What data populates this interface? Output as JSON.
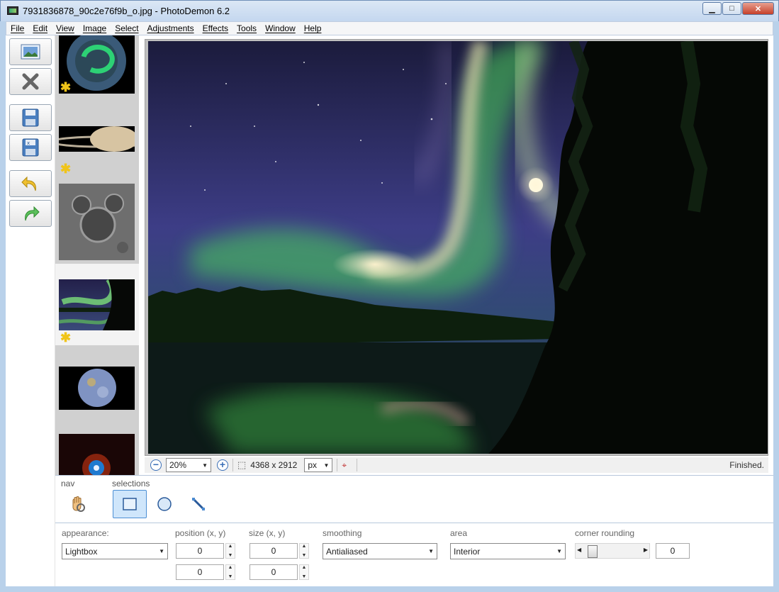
{
  "window": {
    "title": "7931836878_90c2e76f9b_o.jpg  -  PhotoDemon 6.2",
    "controls": [
      "minimize",
      "maximize",
      "close"
    ]
  },
  "menu": [
    "File",
    "Edit",
    "View",
    "Image",
    "Select",
    "Adjustments",
    "Effects",
    "Tools",
    "Window",
    "Help"
  ],
  "toolbar": {
    "buttons": [
      "open-image-icon",
      "close-image-icon",
      "save-icon",
      "save-as-icon",
      "undo-icon",
      "redo-icon"
    ]
  },
  "thumbnails": [
    {
      "name": "aurora-globe",
      "modified": true
    },
    {
      "name": "saturn",
      "modified": true
    },
    {
      "name": "moon-crater",
      "modified": false
    },
    {
      "name": "aurora-river",
      "modified": true,
      "active": true
    },
    {
      "name": "mercury",
      "modified": false
    },
    {
      "name": "nebula",
      "modified": false
    }
  ],
  "statusbar": {
    "zoom": "20%",
    "image_size": "4368 x 2912",
    "unit": "px",
    "status": "Finished."
  },
  "toolpanel": {
    "nav_label": "nav",
    "selections_label": "selections",
    "appearance_label": "appearance:",
    "appearance_value": "Lightbox",
    "position_label": "position (x, y)",
    "position_x": "0",
    "position_y": "0",
    "size_label": "size (x, y)",
    "size_x": "0",
    "size_y": "0",
    "smoothing_label": "smoothing",
    "smoothing_value": "Antialiased",
    "area_label": "area",
    "area_value": "Interior",
    "corner_label": "corner rounding",
    "corner_value": "0"
  }
}
